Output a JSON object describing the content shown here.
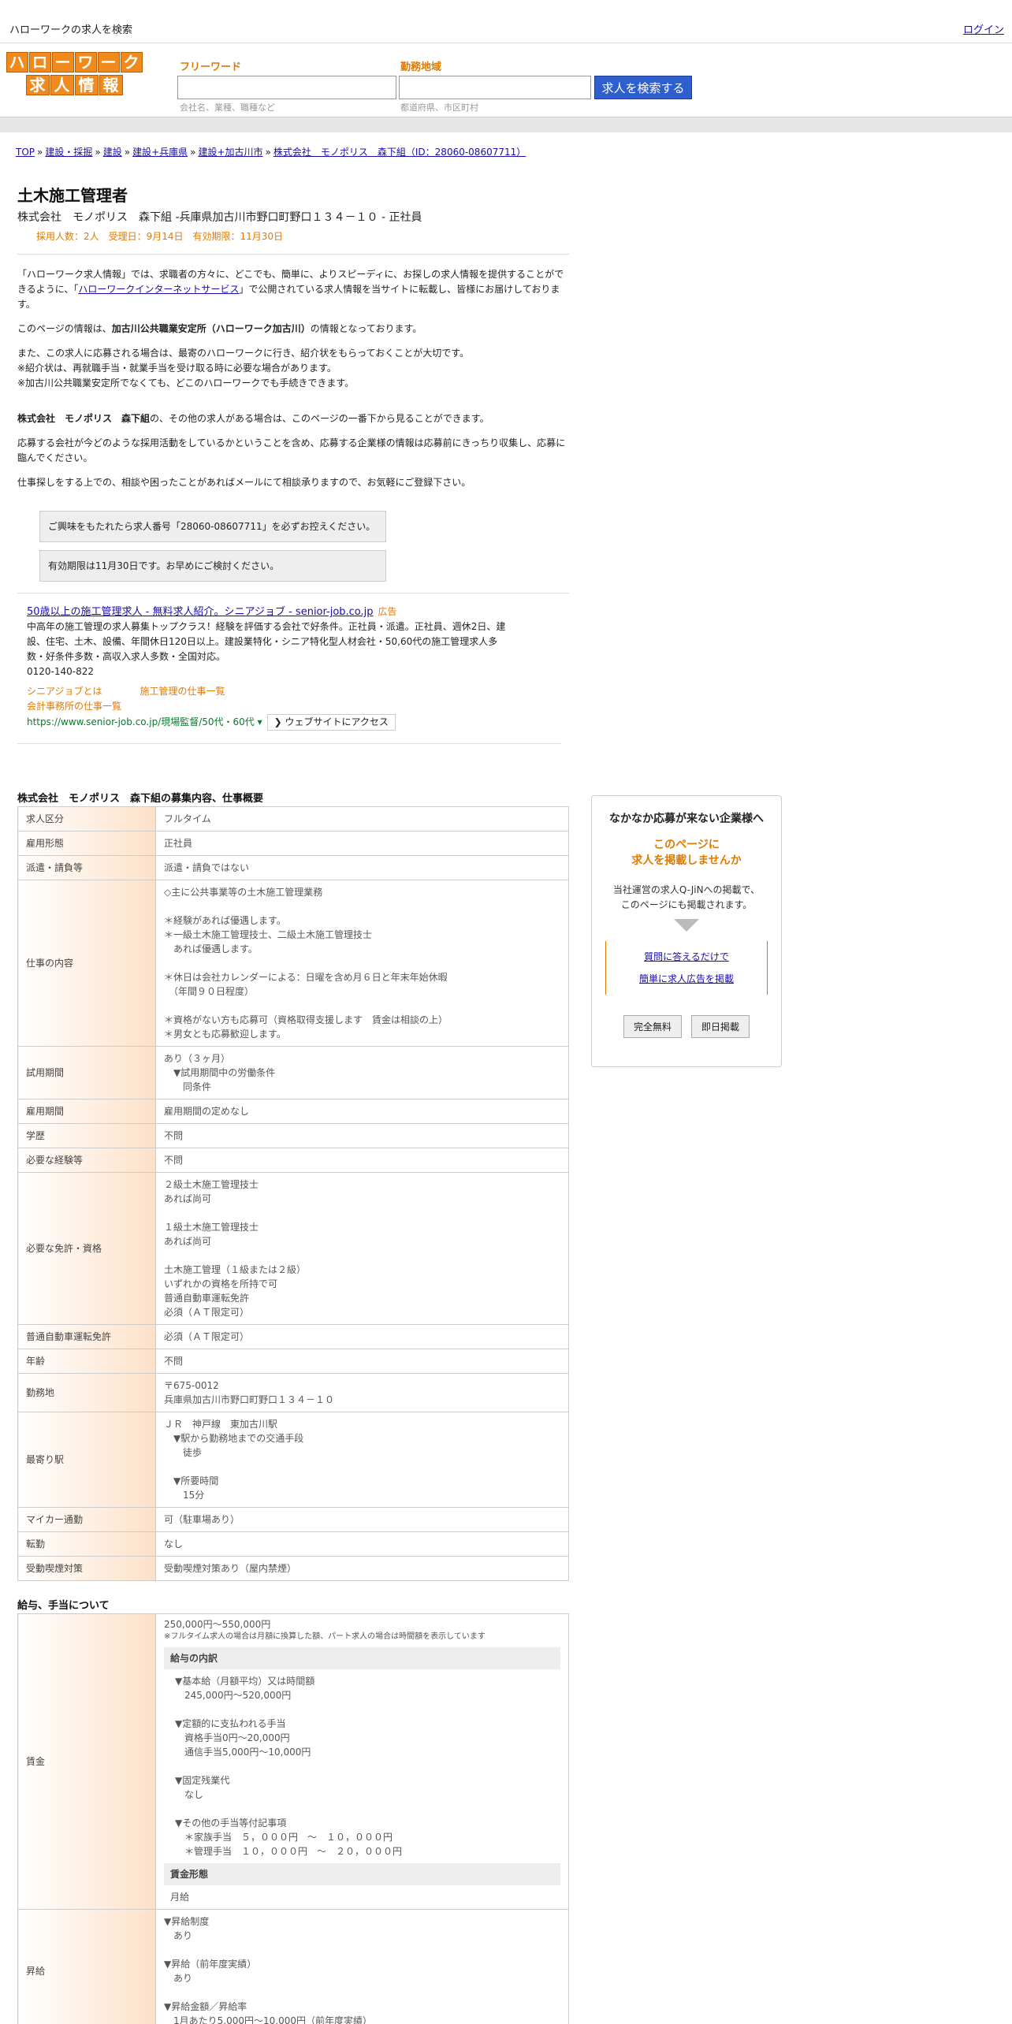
{
  "topbar": {
    "site_link": "ハローワークの求人を検索",
    "login": "ログイン"
  },
  "logo": {
    "row1": [
      "ハ",
      "ロ",
      "ー",
      "ワ",
      "ー",
      "ク"
    ],
    "row2": [
      "求",
      "人",
      "情",
      "報"
    ]
  },
  "search": {
    "freeword_label": "フリーワード",
    "area_label": "勤務地域",
    "freeword_hint": "会社名、業種、職種など",
    "area_hint": "都道府県、市区町村",
    "button": "求人を検索する"
  },
  "breadcrumb": [
    "TOP",
    "建設・採掘",
    "建設",
    "建設+兵庫県",
    "建設+加古川市",
    "株式会社　モノポリス　森下組（ID：28060-08607711）"
  ],
  "job": {
    "title": "土木施工管理者",
    "company_line": "株式会社　モノポリス　森下組 -兵庫県加古川市野口町野口１３４－１０ - 正社員",
    "meta": "採用人数：2人　受理日：9月14日　有効期限：11月30日"
  },
  "intro": {
    "p1_a": "「ハローワーク求人情報」では、求職者の方々に、どこでも、簡単に、よりスピーディに、お探しの求人情報を提供することができるように、「",
    "p1_link": "ハローワークインターネットサービス",
    "p1_b": "」で公開されている求人情報を当サイトに転載し、皆様にお届けしております。",
    "p2_a": "このページの情報は、",
    "p2_bold": "加古川公共職業安定所（ハローワーク加古川）",
    "p2_b": "の情報となっております。",
    "p3_l1": "また、この求人に応募される場合は、最寄のハローワークに行き、紹介状をもらっておくことが大切です。",
    "p3_l2": "※紹介状は、再就職手当・就業手当を受け取る時に必要な場合があります。",
    "p3_l3": "※加古川公共職業安定所でなくても、どこのハローワークでも手続きできます。",
    "p4_bold1": "株式会社　モノポリス　森下組",
    "p4_a": "の、その他の求人がある場合は、このページの一番下から見ることができます。",
    "p5": "応募する会社が今どのような採用活動をしているかということを含め、応募する企業様の情報は応募前にきっちり収集し、応募に臨んでください。",
    "p6": "仕事探しをする上での、相談や困ったことがあればメールにて相談承りますので、お気軽にご登録下さい。",
    "box1": "ご興味をもたれたら求人番号「28060-08607711」を必ずお控えください。",
    "box2": "有効期限は11月30日です。お早めにご検討ください。"
  },
  "ad": {
    "title": "50歳以上の施工管理求人 - 無料求人紹介。シニアジョブ - senior-job.co.jp",
    "tag": "広告",
    "desc": "中高年の施工管理の求人募集トップクラス！経験を評価する会社で好条件。正社員・派遣。正社員、週休2日、建設、住宅、土木、設備、年間休日120日以上。建設業特化・シニア特化型人材会社・50,60代の施工管理求人多数・好条件多数・高収入求人多数・全国対応。",
    "phone": "0120-140-822",
    "link1": "シニアジョブとは",
    "link2": "施工管理の仕事一覧",
    "link3": "会計事務所の仕事一覧",
    "url": "https://www.senior-job.co.jp/現場監督/50代・60代",
    "visit": "❯ ウェブサイトにアクセス"
  },
  "detail": {
    "section_title": "株式会社　モノポリス　森下組の募集内容、仕事概要",
    "rows": [
      {
        "k": "求人区分",
        "v": [
          "フルタイム"
        ]
      },
      {
        "k": "雇用形態",
        "v": [
          "正社員"
        ]
      },
      {
        "k": "派遣・請負等",
        "v": [
          "派遣・請負ではない"
        ]
      },
      {
        "k": "仕事の内容",
        "v": [
          "◇主に公共事業等の土木施工管理業務",
          "",
          "＊経験があれば優遇します。",
          "＊一級土木施工管理技士、二級土木施工管理技士",
          "　あれば優遇します。",
          "",
          "＊休日は会社カレンダーによる：日曜を含め月６日と年末年始休暇",
          "　（年間９０日程度）",
          "",
          "＊資格がない方も応募可（資格取得支援します　賃金は相談の上）",
          "＊男女とも応募歓迎します。"
        ]
      },
      {
        "k": "試用期間",
        "v": [
          "あり（３ヶ月）",
          "　▼試用期間中の労働条件",
          "　　同条件"
        ]
      },
      {
        "k": "雇用期間",
        "v": [
          "雇用期間の定めなし"
        ]
      },
      {
        "k": "学歴",
        "v": [
          "不問"
        ]
      },
      {
        "k": "必要な経験等",
        "v": [
          "不問"
        ]
      },
      {
        "k": "必要な免許・資格",
        "v": [
          "２級土木施工管理技士",
          "あれば尚可",
          "",
          "１級土木施工管理技士",
          "あれば尚可",
          "",
          "土木施工管理（１級または２級）",
          "いずれかの資格を所持で可",
          "普通自動車運転免許",
          "必須（ＡＴ限定可）"
        ]
      },
      {
        "k": "普通自動車運転免許",
        "v": [
          "必須（ＡＴ限定可）"
        ]
      },
      {
        "k": "年齢",
        "v": [
          "不問"
        ]
      },
      {
        "k": "勤務地",
        "v": [
          "〒675-0012",
          "兵庫県加古川市野口町野口１３４－１０"
        ]
      },
      {
        "k": "最寄り駅",
        "v": [
          "ＪＲ　神戸線　東加古川駅",
          "　▼駅から勤務地までの交通手段",
          "　　徒歩",
          "",
          "　▼所要時間",
          "　　15分"
        ]
      },
      {
        "k": "マイカー通勤",
        "v": [
          "可（駐車場あり）"
        ]
      },
      {
        "k": "転勤",
        "v": [
          "なし"
        ]
      },
      {
        "k": "受動喫煙対策",
        "v": [
          "受動喫煙対策あり（屋内禁煙）"
        ]
      }
    ]
  },
  "salary": {
    "section_title": "給与、手当について",
    "wage_key": "賃金",
    "wage_range": "250,000円〜550,000円",
    "wage_note": "※フルタイム求人の場合は月額に換算した額、パート求人の場合は時間額を表示しています",
    "breakdown_head": "給与の内訳",
    "breakdown": [
      "▼基本給（月額平均）又は時間額",
      "　245,000円〜520,000円",
      "",
      "▼定額的に支払われる手当",
      "　資格手当0円〜20,000円",
      "　通信手当5,000円〜10,000円",
      "",
      "▼固定残業代",
      "　なし",
      "",
      "▼その他の手当等付記事項",
      "　＊家族手当　５，０００円　～　１０，０００円",
      "　＊管理手当　１０，０００円　～　２０，０００円"
    ],
    "form_head": "賃金形態",
    "form_value": "月給",
    "raise_key": "昇給",
    "raise": [
      "▼昇給制度",
      "　あり",
      "",
      "▼昇給（前年度実績）",
      "　あり",
      "",
      "▼昇給金額／昇給率",
      "　1月あたり5,000円〜10,000円（前年度実績）"
    ]
  },
  "side": {
    "t1": "なかなか応募が来ない企業様へ",
    "t2_l1": "このページに",
    "t2_l2": "求人を掲載しませんか",
    "t3_l1": "当社運営の求人Q-JiNへの掲載で、",
    "t3_l2": "このページにも掲載されます。",
    "link1": "質問に答えるだけで",
    "link2": "簡単に求人広告を掲載",
    "btn1": "完全無料",
    "btn2": "即日掲載"
  }
}
